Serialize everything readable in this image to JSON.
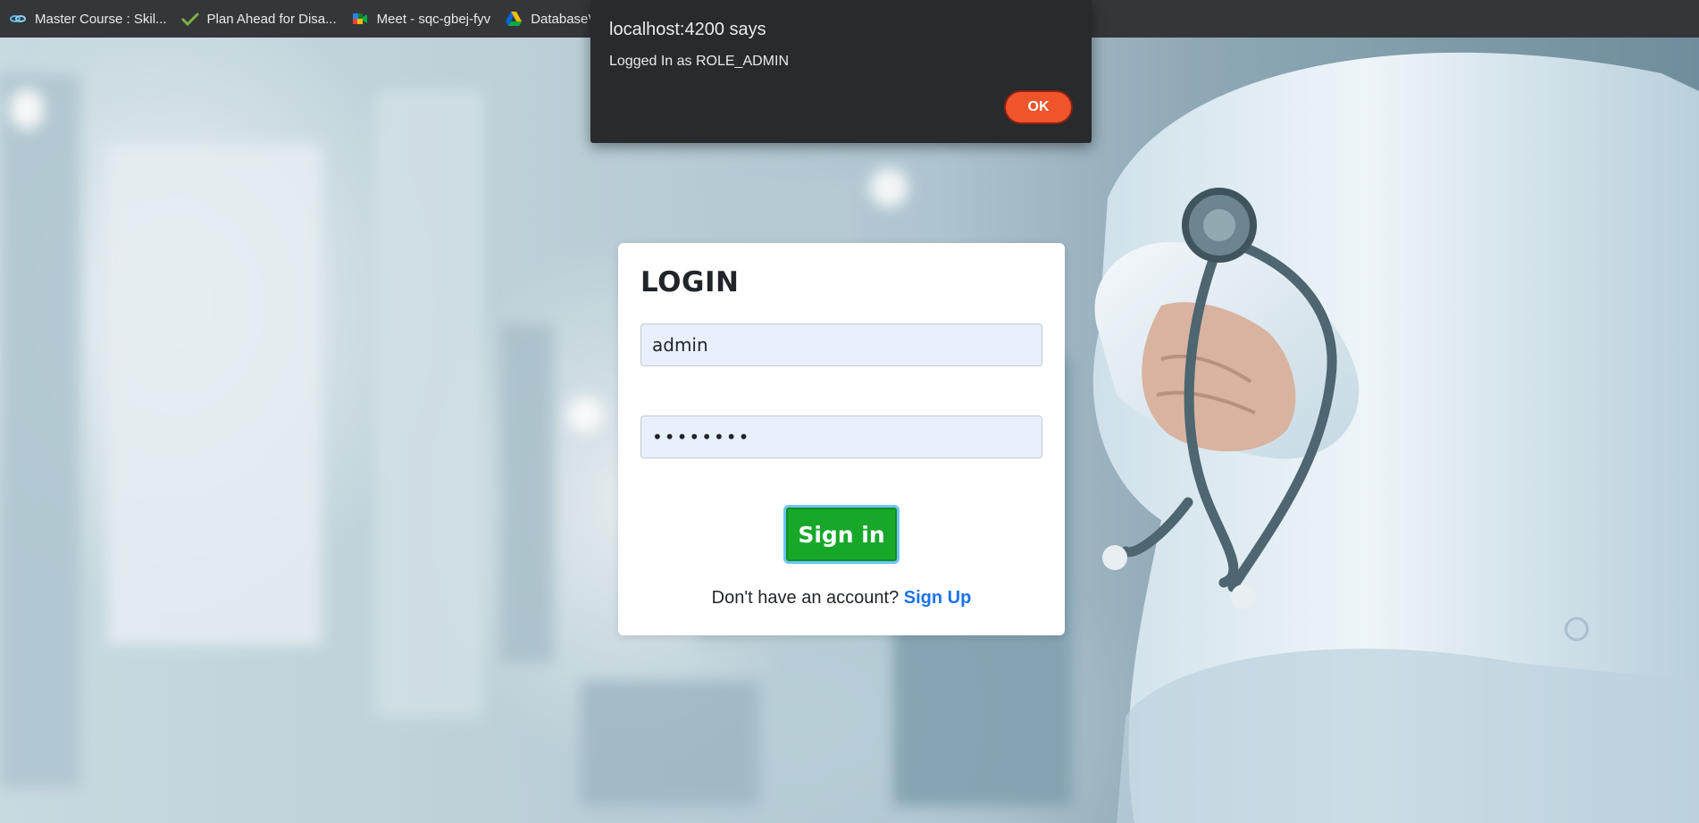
{
  "bookmarks": [
    {
      "label": "Master Course : Skil...",
      "icon": "link-icon"
    },
    {
      "label": "Plan Ahead for Disa...",
      "icon": "checkmark-icon"
    },
    {
      "label": "Meet - sqc-gbej-fyv",
      "icon": "meet-icon"
    },
    {
      "label": "DatabaseV",
      "icon": "drive-icon"
    }
  ],
  "alert": {
    "title": "localhost:4200 says",
    "message": "Logged In as ROLE_ADMIN",
    "ok_label": "OK",
    "ok_color": "#f0542b"
  },
  "login": {
    "title": "LOGIN",
    "username_value": "admin",
    "password_value": "••••••••",
    "signin_label": "Sign in",
    "signin_color": "#17a82a",
    "signup_prompt": "Don't have an account?",
    "signup_link": "Sign Up"
  }
}
